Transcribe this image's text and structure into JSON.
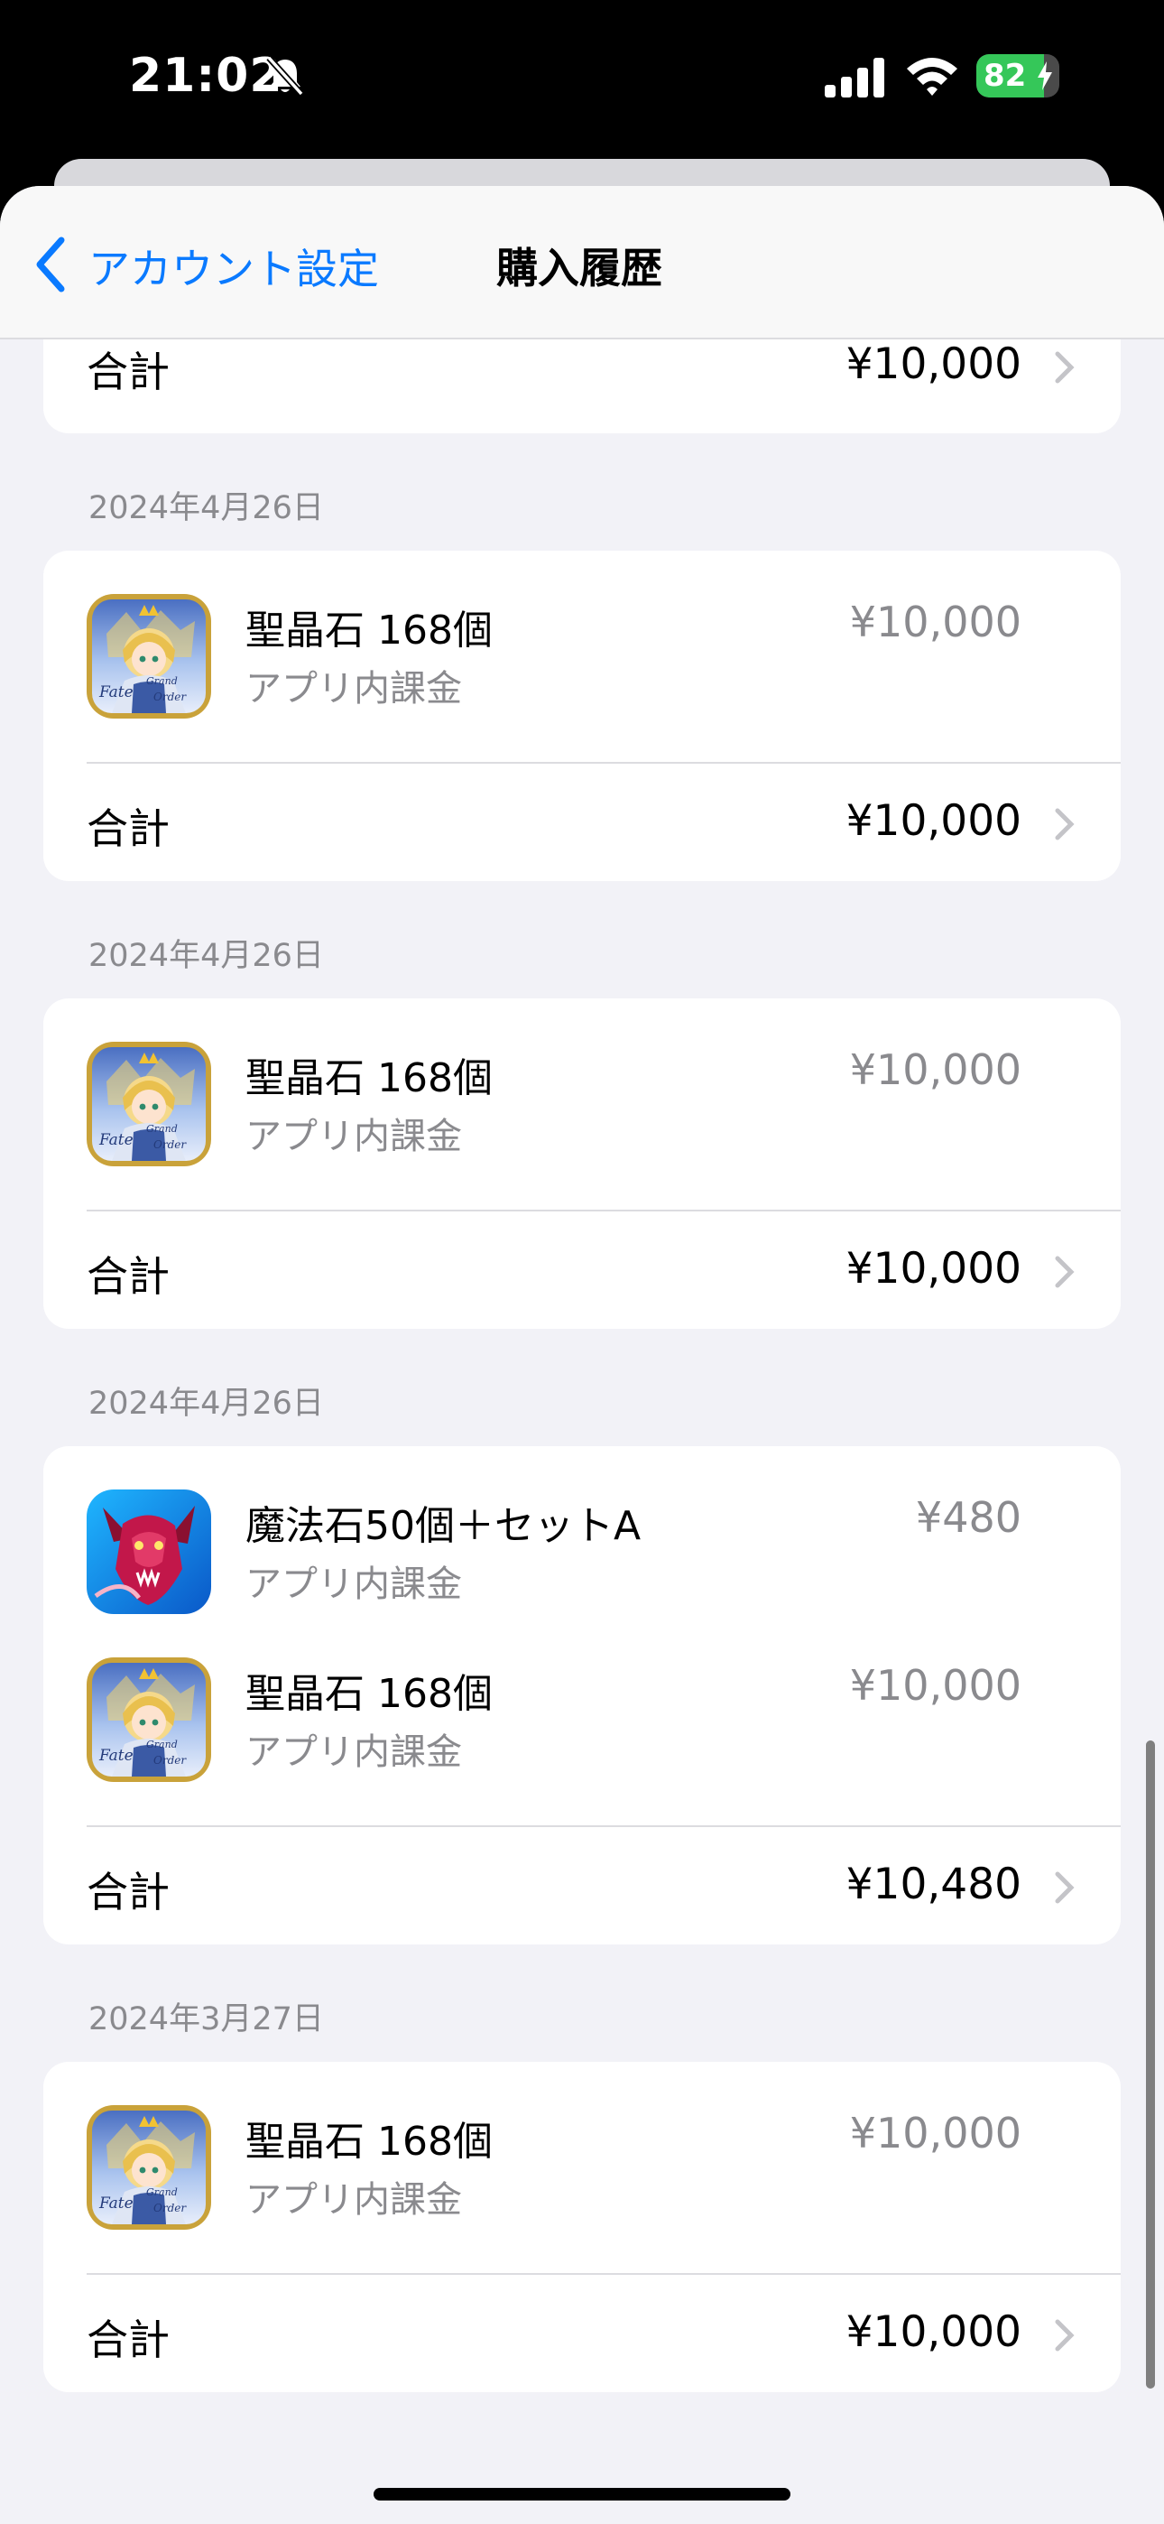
{
  "status_bar": {
    "time": "21:02",
    "battery": "82",
    "battery_level": 0.82,
    "icons": [
      "bell-slash-icon",
      "cellular-signal-icon",
      "wifi-icon",
      "battery-charging-icon"
    ]
  },
  "nav": {
    "back_label": "アカウント設定",
    "title": "購入履歴",
    "accent_color": "#0a7aff"
  },
  "total_label": "合計",
  "in_app_label": "アプリ内課金",
  "top_partial_total": "¥10,000",
  "purchases": [
    {
      "date": "2024年4月26日",
      "items": [
        {
          "title": "聖晶石 168個",
          "type": "アプリ内課金",
          "price": "¥10,000",
          "icon": "fate-grand-order-icon"
        }
      ],
      "total": "¥10,000"
    },
    {
      "date": "2024年4月26日",
      "items": [
        {
          "title": "聖晶石 168個",
          "type": "アプリ内課金",
          "price": "¥10,000",
          "icon": "fate-grand-order-icon"
        }
      ],
      "total": "¥10,000"
    },
    {
      "date": "2024年4月26日",
      "items": [
        {
          "title": "魔法石50個＋セットA",
          "type": "アプリ内課金",
          "price": "¥480",
          "icon": "puzzle-and-dragons-icon"
        },
        {
          "title": "聖晶石 168個",
          "type": "アプリ内課金",
          "price": "¥10,000",
          "icon": "fate-grand-order-icon"
        }
      ],
      "total": "¥10,480"
    },
    {
      "date": "2024年3月27日",
      "items": [
        {
          "title": "聖晶石 168個",
          "type": "アプリ内課金",
          "price": "¥10,000",
          "icon": "fate-grand-order-icon"
        }
      ],
      "total": "¥10,000"
    }
  ]
}
